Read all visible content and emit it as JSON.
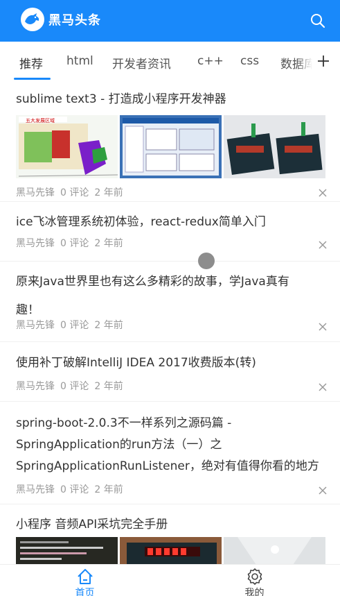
{
  "header": {
    "brand": "黑马头条",
    "colors": {
      "primary": "#1989fa"
    }
  },
  "tabs": [
    {
      "label": "推荐",
      "active": true
    },
    {
      "label": "html"
    },
    {
      "label": "开发者资讯"
    },
    {
      "label": "c++"
    },
    {
      "label": "css"
    },
    {
      "label": "数据库"
    }
  ],
  "articles": [
    {
      "title": "sublime text3 - 打造成小程序开发神器",
      "author": "黑马先锋",
      "comments": "0 评论",
      "time": "2 年前"
    },
    {
      "title": "ice飞冰管理系统初体验，react-redux简单入门",
      "author": "黑马先锋",
      "comments": "0 评论",
      "time": "2 年前"
    },
    {
      "title_line1": "原来Java世界里也有这么多精彩的故事，学Java真有",
      "title_line2": "趣！",
      "author": "黑马先锋",
      "comments": "0 评论",
      "time": "2 年前"
    },
    {
      "title": "使用补丁破解IntelliJ IDEA 2017收费版本(转)",
      "author": "黑马先锋",
      "comments": "0 评论",
      "time": "2 年前"
    },
    {
      "title_line1": "spring-boot-2.0.3不一样系列之源码篇 -",
      "title_line2": "SpringApplication的run方法（一）之",
      "title_line3": "SpringApplicationRunListener，绝对有值得你看的地方",
      "author": "黑马先锋",
      "comments": "0 评论",
      "time": "2 年前"
    },
    {
      "title": "小程序 音频API采坑完全手册"
    }
  ],
  "tabbar": [
    {
      "label": "首页",
      "icon": "home-icon",
      "active": true
    },
    {
      "label": "我的",
      "icon": "gear-icon",
      "active": false
    }
  ]
}
